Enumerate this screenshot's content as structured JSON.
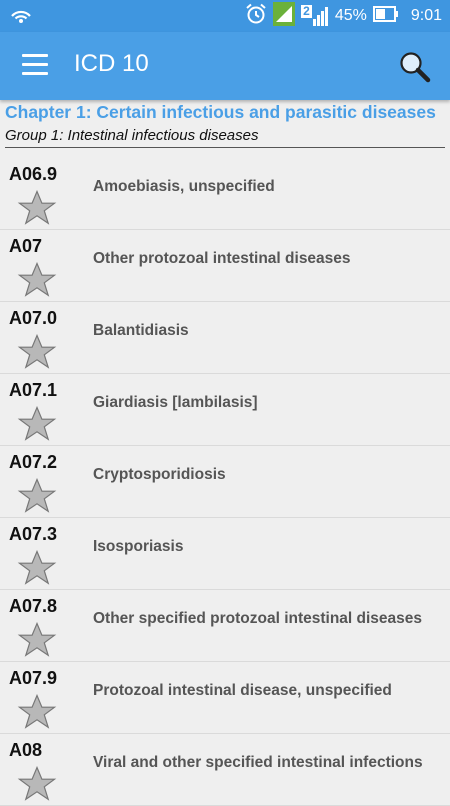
{
  "status_bar": {
    "battery_percent": "45%",
    "time": "9:01",
    "sim_number": "2",
    "icons": [
      "wifi-hotspot-icon",
      "alarm-icon",
      "signal-icon",
      "signal-icon",
      "battery-icon"
    ]
  },
  "app_bar": {
    "title": "ICD 10",
    "menu_icon": "hamburger-menu-icon",
    "search_icon": "search-icon"
  },
  "chapter": {
    "title": "Chapter 1: Certain infectious and parasitic diseases",
    "group": "Group 1: Intestinal infectious diseases"
  },
  "entries": [
    {
      "code": "A06.9",
      "description": "Amoebiasis, unspecified"
    },
    {
      "code": "A07",
      "description": "Other protozoal intestinal diseases"
    },
    {
      "code": "A07.0",
      "description": "Balantidiasis"
    },
    {
      "code": "A07.1",
      "description": "Giardiasis [lambilasis]"
    },
    {
      "code": "A07.2",
      "description": "Cryptosporidiosis"
    },
    {
      "code": "A07.3",
      "description": "Isosporiasis"
    },
    {
      "code": "A07.8",
      "description": "Other specified protozoal intestinal diseases"
    },
    {
      "code": "A07.9",
      "description": "Protozoal intestinal disease, unspecified"
    },
    {
      "code": "A08",
      "description": "Viral and other specified intestinal infections"
    }
  ],
  "colors": {
    "accent": "#4a9fe6",
    "status_bar": "#3f96e0",
    "background": "#efefef",
    "star_fill": "#b8b8b8",
    "description_text": "#555555"
  }
}
